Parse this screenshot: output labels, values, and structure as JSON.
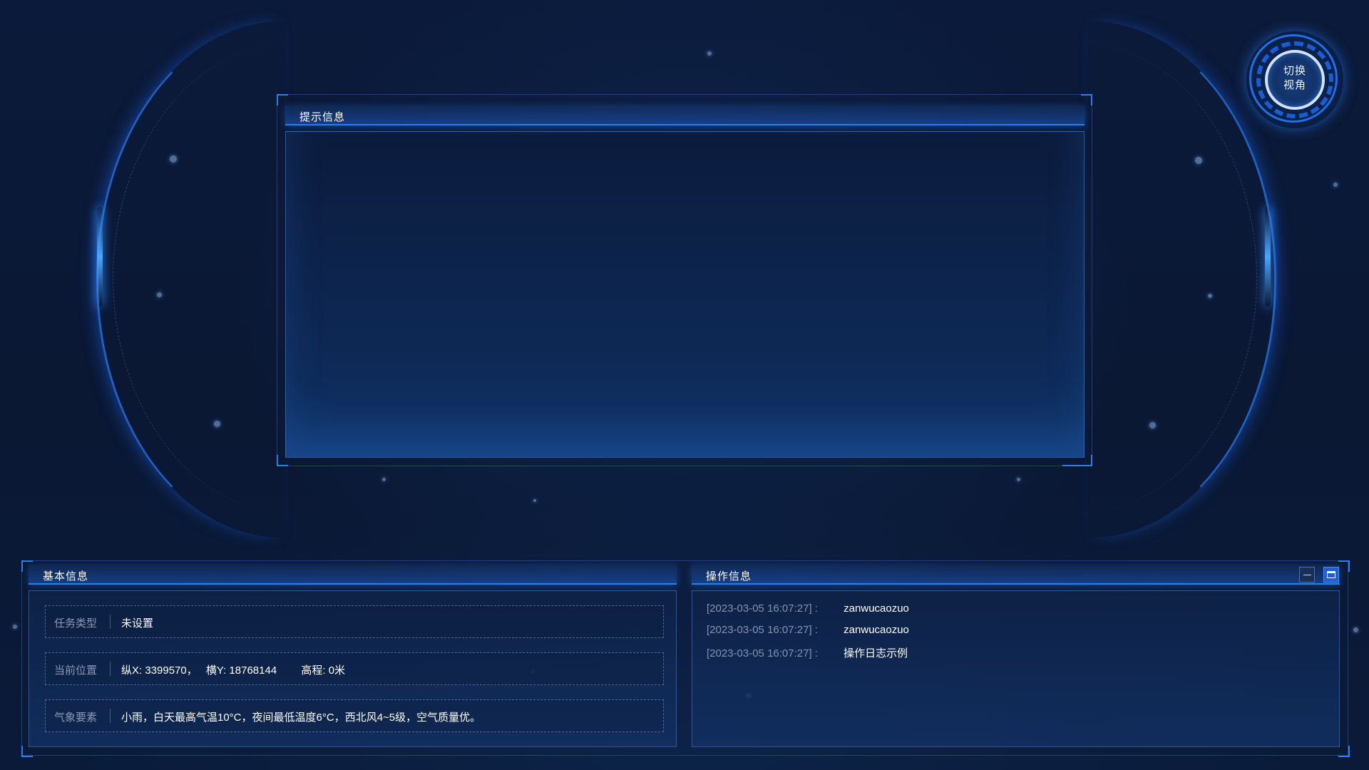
{
  "view_switch": {
    "label": "切换\n视角"
  },
  "tip_panel": {
    "title": "提示信息"
  },
  "basic_panel": {
    "title": "基本信息",
    "rows": [
      {
        "key": "任务类型",
        "value": "未设置"
      },
      {
        "key": "当前位置",
        "x_value": "纵X: 3399570，",
        "y_value": "横Y: 18768144",
        "h_value": "高程: 0米"
      },
      {
        "key": "气象要素",
        "value": "小雨，白天最高气温10°C，夜间最低温度6°C，西北风4~5级，空气质量优。"
      }
    ]
  },
  "ops_panel": {
    "title": "操作信息",
    "logs": [
      {
        "time": "[2023-03-05 16:07:27] :",
        "msg": "zanwucaozuo"
      },
      {
        "time": "[2023-03-05 16:07:27] :",
        "msg": "zanwucaozuo"
      },
      {
        "time": "[2023-03-05 16:07:27] :",
        "msg": "操作日志示例"
      }
    ],
    "minimize_icon": "minimize-icon",
    "maximize_icon": "maximize-icon"
  },
  "colors": {
    "background": "#0a1a38",
    "accent": "#2a7ff0",
    "label_grey": "#8a98b2"
  }
}
